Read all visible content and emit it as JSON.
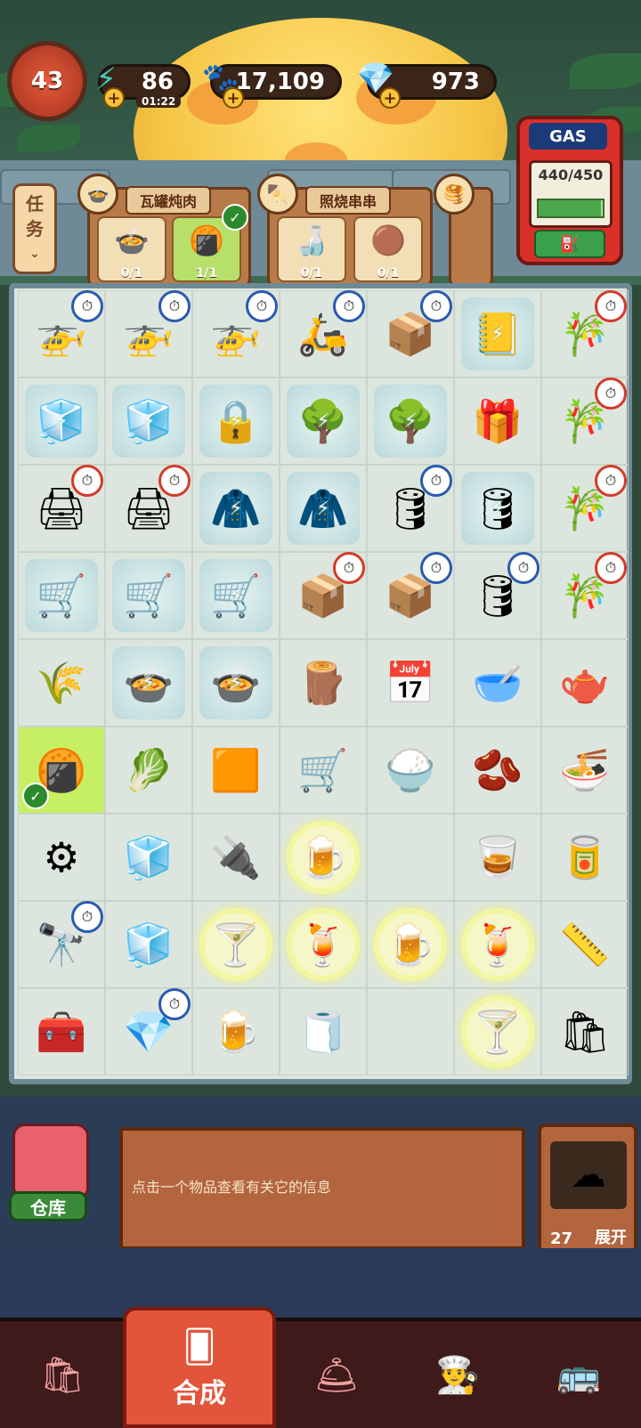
{
  "hud": {
    "level": "43",
    "energy": "86",
    "energy_timer": "01:22",
    "coins": "17,109",
    "gems": "973"
  },
  "gas_station": {
    "label": "GAS",
    "amount": "440/450",
    "fill_fraction": 0.978
  },
  "tasks_tab": {
    "label_1": "任",
    "label_2": "务"
  },
  "orders": [
    {
      "title": "瓦罐炖肉",
      "avatar_icon": "pot-stew-icon",
      "needs": [
        {
          "icon": "pot-stew-icon",
          "count": "0/1",
          "done": false
        },
        {
          "icon": "cracker-icon",
          "count": "1/1",
          "done": true
        }
      ]
    },
    {
      "title": "照烧串串",
      "avatar_icon": "skewer-icon",
      "needs": [
        {
          "icon": "sauce-bottle-icon",
          "count": "0/1",
          "done": false
        },
        {
          "icon": "meatball-icon",
          "count": "0/1",
          "done": false
        }
      ]
    }
  ],
  "board": {
    "rows": [
      [
        {
          "icon": "drone-crate-icon",
          "glyph": "🚁",
          "timer": "blue"
        },
        {
          "icon": "drone-crate-icon",
          "glyph": "🚁",
          "timer": "blue"
        },
        {
          "icon": "drone-crate-icon",
          "glyph": "🚁",
          "timer": "blue"
        },
        {
          "icon": "scooter-icon",
          "glyph": "🛵",
          "timer": "blue"
        },
        {
          "icon": "hand-truck-icon",
          "glyph": "📦",
          "timer": "blue"
        },
        {
          "icon": "notebook-icon",
          "glyph": "📒",
          "locked": true
        },
        {
          "icon": "bamboo-shoot-icon",
          "glyph": "🎋",
          "timer": "red"
        }
      ],
      [
        {
          "icon": "fridge-icon",
          "glyph": "🧊",
          "locked": true
        },
        {
          "icon": "display-fridge-icon",
          "glyph": "🧊",
          "locked": true
        },
        {
          "icon": "safe-icon",
          "glyph": "🔒",
          "locked": true
        },
        {
          "icon": "tree-icon",
          "glyph": "🌳",
          "locked": true
        },
        {
          "icon": "tree-icon",
          "glyph": "🌳",
          "locked": true
        },
        {
          "icon": "gift-box-icon",
          "glyph": "🎁"
        },
        {
          "icon": "bamboo-shoot-icon",
          "glyph": "🎋",
          "timer": "red"
        }
      ],
      [
        {
          "icon": "printer-icon",
          "glyph": "🖨",
          "timer": "red"
        },
        {
          "icon": "printer-icon",
          "glyph": "🖨",
          "timer": "red"
        },
        {
          "icon": "chef-jacket-icon",
          "glyph": "🧥",
          "locked": true
        },
        {
          "icon": "chef-jacket-icon",
          "glyph": "🧥",
          "locked": true
        },
        {
          "icon": "barrel-icon",
          "glyph": "🛢",
          "timer": "blue"
        },
        {
          "icon": "barrel-icon",
          "glyph": "🛢",
          "locked": true
        },
        {
          "icon": "bamboo-shoot-icon",
          "glyph": "🎋",
          "timer": "red"
        }
      ],
      [
        {
          "icon": "shelf-cart-icon",
          "glyph": "🛒",
          "locked": true
        },
        {
          "icon": "shelf-cart-icon",
          "glyph": "🛒",
          "locked": true
        },
        {
          "icon": "shelf-cart-icon",
          "glyph": "🛒",
          "locked": true
        },
        {
          "icon": "open-box-icon",
          "glyph": "📦",
          "timer": "red"
        },
        {
          "icon": "open-box-icon",
          "glyph": "📦",
          "timer": "blue"
        },
        {
          "icon": "barrel-icon",
          "glyph": "🛢",
          "timer": "blue"
        },
        {
          "icon": "bamboo-shoot-icon",
          "glyph": "🎋",
          "timer": "red"
        }
      ],
      [
        {
          "icon": "grain-mat-icon",
          "glyph": "🌾"
        },
        {
          "icon": "steamer-icon",
          "glyph": "🍲",
          "locked": true
        },
        {
          "icon": "steamer-icon",
          "glyph": "🍲",
          "locked": true
        },
        {
          "icon": "wood-pieces-icon",
          "glyph": "🪵"
        },
        {
          "icon": "calendar-icon",
          "glyph": "📅"
        },
        {
          "icon": "bowl-icon",
          "glyph": "🥣"
        },
        {
          "icon": "teapot-icon",
          "glyph": "🫖"
        }
      ],
      [
        {
          "icon": "cracker-icon",
          "glyph": "🍘",
          "selected": true,
          "check": true
        },
        {
          "icon": "lettuce-icon",
          "glyph": "🥬"
        },
        {
          "icon": "napkin-icon",
          "glyph": "🟧"
        },
        {
          "icon": "dolly-icon",
          "glyph": "🛒"
        },
        {
          "icon": "rice-mat-icon",
          "glyph": "🍚"
        },
        {
          "icon": "bean-sack-icon",
          "glyph": "🫘"
        },
        {
          "icon": "soup-bowl-icon",
          "glyph": "🍜"
        }
      ],
      [
        {
          "icon": "gear-icon",
          "glyph": "⚙"
        },
        {
          "icon": "ice-cube-icon",
          "glyph": "🧊"
        },
        {
          "icon": "plug-icon",
          "glyph": "🔌"
        },
        {
          "icon": "beer-glass-icon",
          "glyph": "🍺",
          "glow": true
        },
        {
          "icon": "",
          "glyph": ""
        },
        {
          "icon": "juice-glass-icon",
          "glyph": "🥃"
        },
        {
          "icon": "ketchup-icon",
          "glyph": "🥫"
        }
      ],
      [
        {
          "icon": "telescope-icon",
          "glyph": "🔭",
          "timer": "blue"
        },
        {
          "icon": "sugar-cube-icon",
          "glyph": "🧊"
        },
        {
          "icon": "cocktail-icon",
          "glyph": "🍸",
          "glow": true
        },
        {
          "icon": "red-drink-icon",
          "glyph": "🍹",
          "glow": true
        },
        {
          "icon": "mug-drink-icon",
          "glyph": "🍺",
          "glow": true
        },
        {
          "icon": "sunset-drink-icon",
          "glyph": "🍹",
          "glow": true
        },
        {
          "icon": "ruler-icon",
          "glyph": "📏"
        }
      ],
      [
        {
          "icon": "power-box-icon",
          "glyph": "🧰"
        },
        {
          "icon": "crystal-icon",
          "glyph": "💎",
          "timer": "blue"
        },
        {
          "icon": "beer-glass-icon",
          "glyph": "🍺"
        },
        {
          "icon": "napkin-icon",
          "glyph": "🧻"
        },
        {
          "icon": "",
          "glyph": ""
        },
        {
          "icon": "blue-cocktail-icon",
          "glyph": "🍸",
          "glow": true
        },
        {
          "icon": "paper-bag-icon",
          "glyph": "🛍"
        }
      ]
    ]
  },
  "info_panel": {
    "message": "点击一个物品查看有关它的信息"
  },
  "warehouse": {
    "label": "仓库"
  },
  "queue": {
    "count": "27",
    "expand_label": "展开"
  },
  "nav": {
    "items": [
      {
        "icon": "shop-bag-icon",
        "glyph": "🛍"
      },
      {
        "icon": "merge-cards-icon",
        "label": "合成",
        "active": true
      },
      {
        "icon": "service-bell-icon",
        "glyph": "🛎"
      },
      {
        "icon": "chef-profile-icon",
        "glyph": "👨‍🍳"
      },
      {
        "icon": "bus-icon",
        "glyph": "🚌"
      }
    ]
  }
}
